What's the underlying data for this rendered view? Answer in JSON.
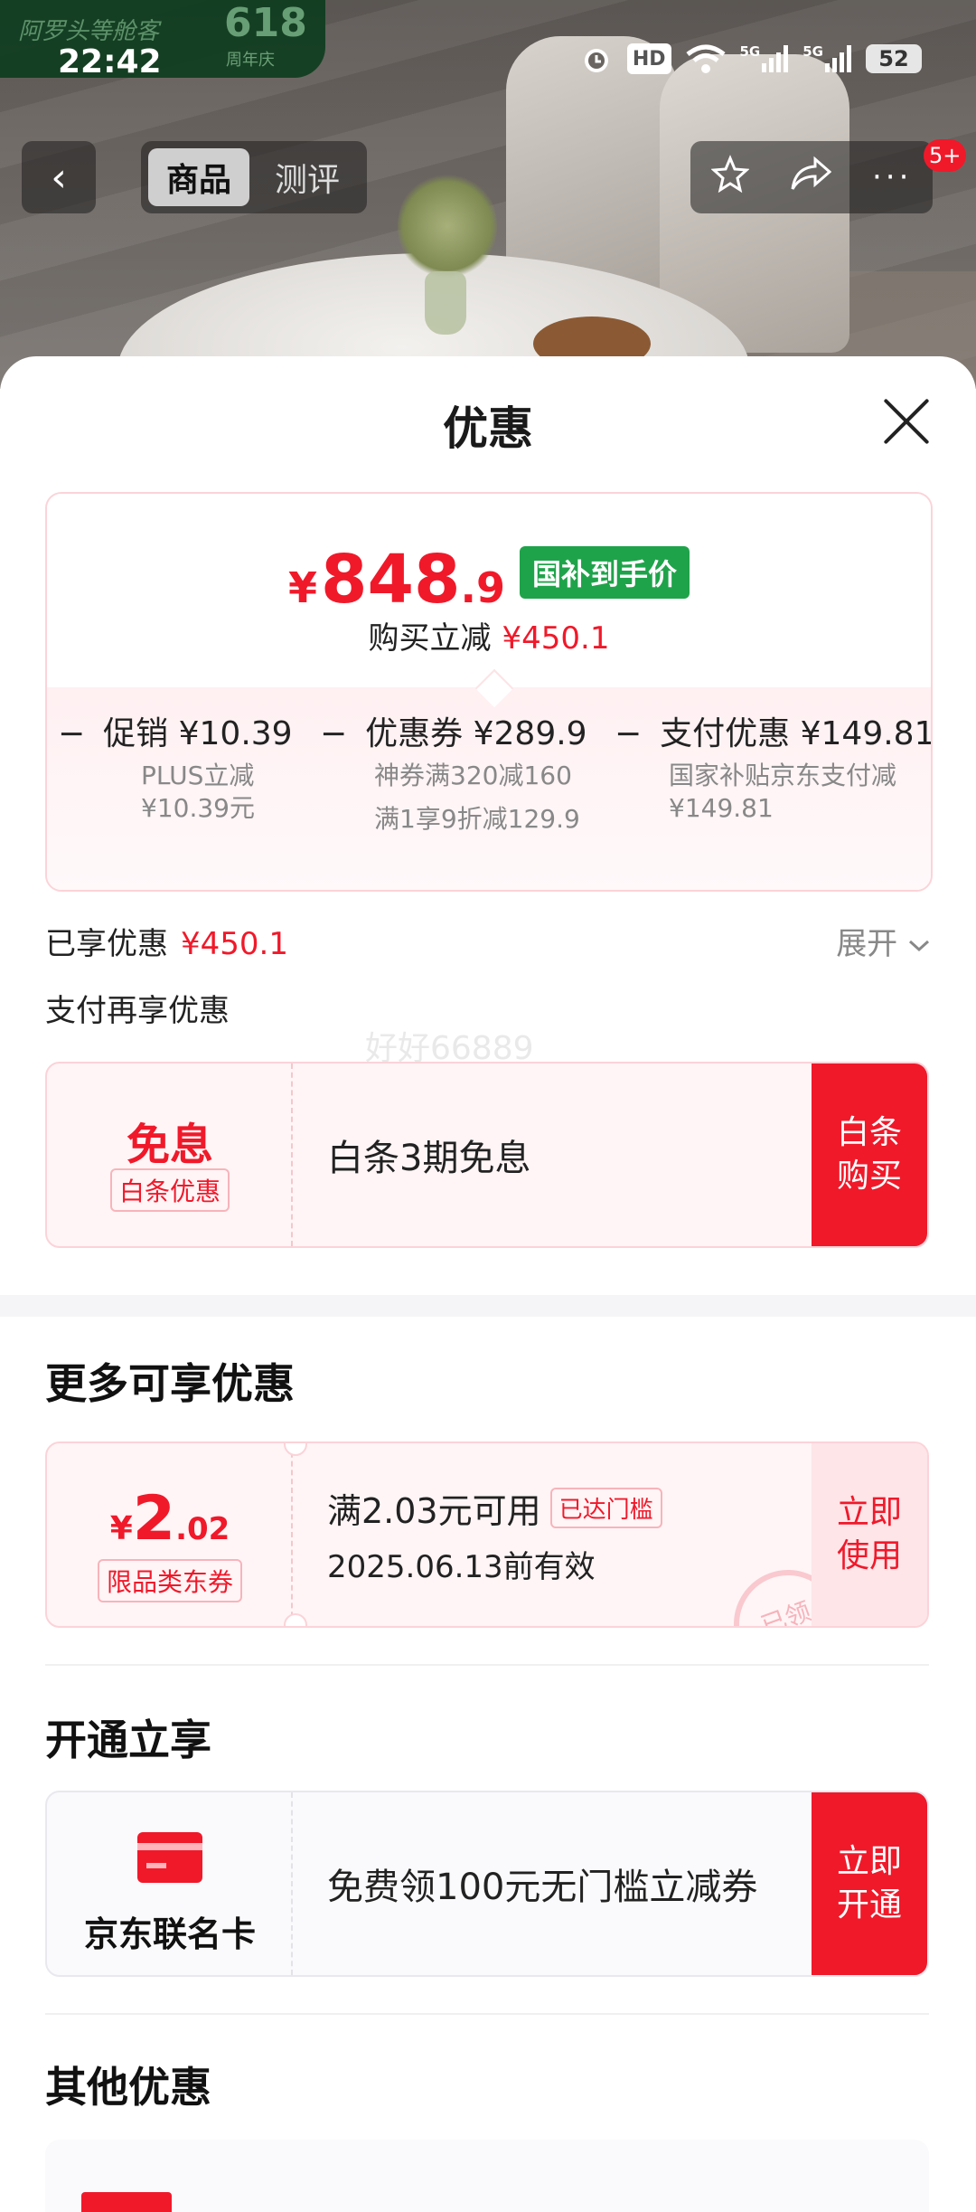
{
  "status_bar": {
    "time": "22:42",
    "battery": "52",
    "hd_label": "HD",
    "signal_label_1": "5G",
    "signal_label_2": "5G"
  },
  "photo_brand": {
    "text": "阿罗头等舱客",
    "event": "618",
    "event_sub": "周年庆"
  },
  "nav": {
    "tabs": [
      {
        "label": "商品"
      },
      {
        "label": "测评"
      }
    ],
    "badge": "5+"
  },
  "sheet": {
    "title": "优惠",
    "price": {
      "currency": "¥",
      "integer": "848",
      "decimal": ".9",
      "badge": "国补到手价"
    },
    "save": {
      "label": "购买立减",
      "amount": "¥450.1"
    },
    "discounts": [
      {
        "sign": "−",
        "label": "促销 ¥10.39",
        "details": [
          "PLUS立减",
          "¥10.39元"
        ]
      },
      {
        "sign": "−",
        "label": "优惠券 ¥289.9",
        "details": [
          "神券满320减160",
          "满1享9折减129.9"
        ]
      },
      {
        "sign": "−",
        "label": "支付优惠 ¥149.81",
        "details": [
          "国家补贴京东支付减",
          "¥149.81"
        ]
      }
    ],
    "enjoyed": {
      "label": "已享优惠",
      "amount": "¥450.1"
    },
    "expand_label": "展开",
    "pay_more_label": "支付再享优惠",
    "watermark": "好好66889",
    "baitiao": {
      "big": "免息",
      "tag": "白条优惠",
      "text": "白条3期免息",
      "cta_1": "白条",
      "cta_2": "购买"
    },
    "more_title": "更多可享优惠",
    "coupon": {
      "currency": "¥",
      "integer": "2",
      "decimal": ".02",
      "tag": "限品类东券",
      "condition": "满2.03元可用",
      "status_tag": "已达门槛",
      "expiry": "2025.06.13前有效",
      "stamp": "已领",
      "cta_1": "立即",
      "cta_2": "使用"
    },
    "open_title": "开通立享",
    "card": {
      "label": "京东联名卡",
      "text": "免费领100元无门槛立减券",
      "cta_1": "立即",
      "cta_2": "开通"
    },
    "other_title": "其他优惠"
  },
  "colors": {
    "accent": "#f0192a",
    "green_badge": "#1fa34a",
    "soft_pink": "#fff5f6"
  },
  "icons": [
    "back-icon",
    "star-icon",
    "share-icon",
    "more-icon",
    "close-icon",
    "chevron-down-icon",
    "card-icon",
    "alarm-icon",
    "wifi-icon"
  ]
}
